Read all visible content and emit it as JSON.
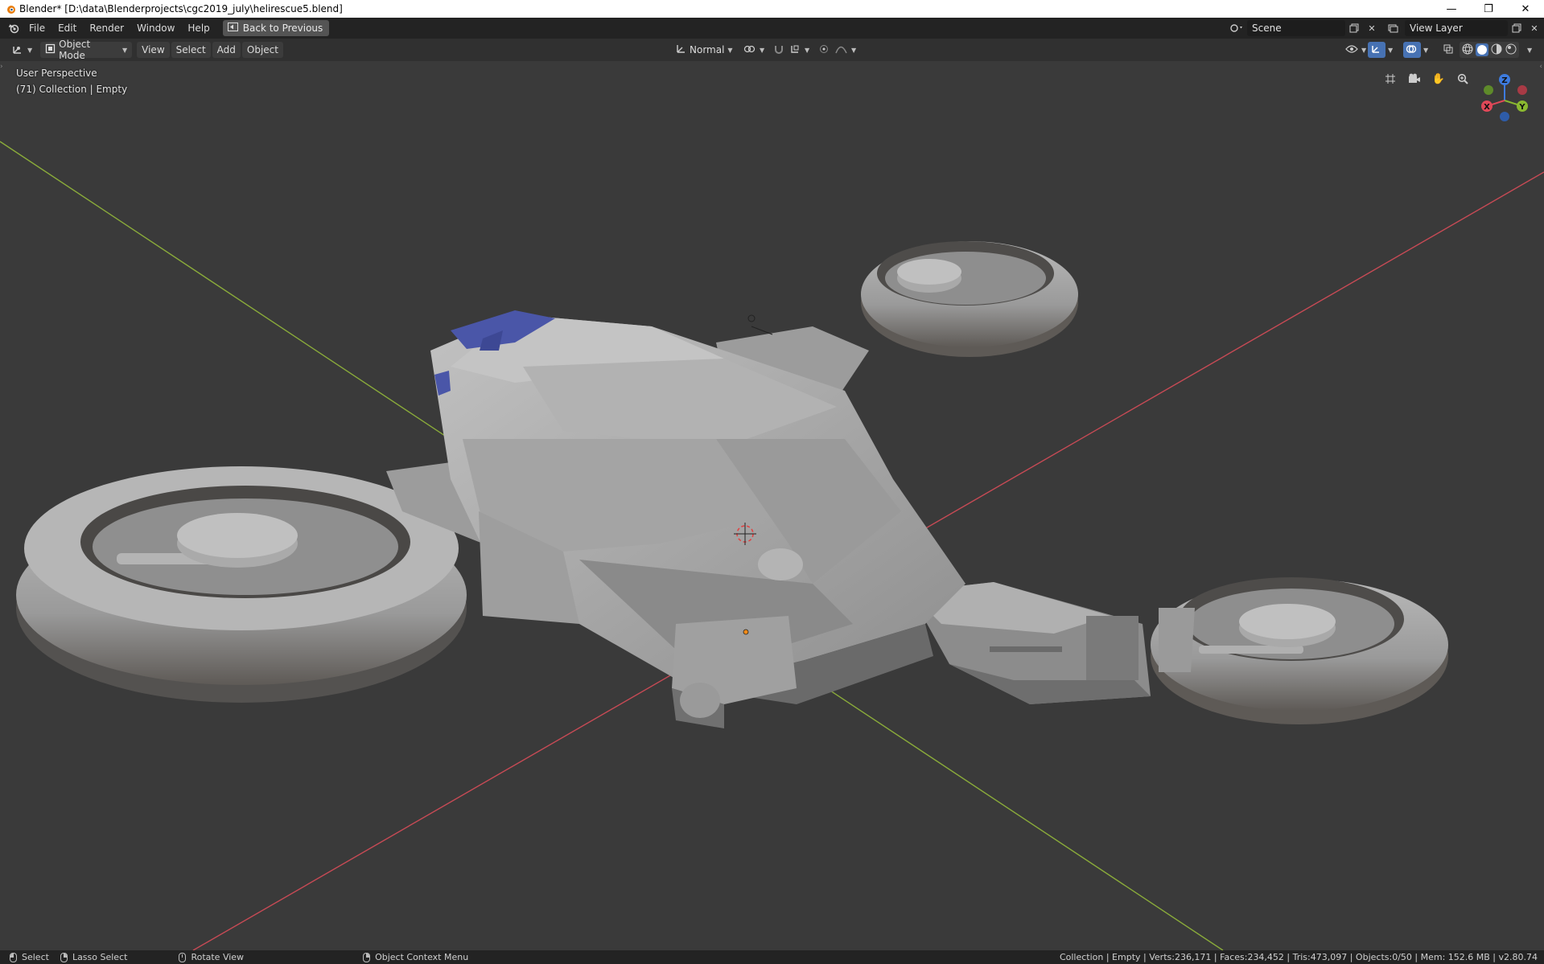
{
  "window": {
    "title": "Blender* [D:\\data\\Blenderprojects\\cgc2019_july\\helirescue5.blend]",
    "controls": {
      "minimize": "—",
      "restore": "❐",
      "close": "✕"
    }
  },
  "topbar": {
    "menus": [
      "File",
      "Edit",
      "Render",
      "Window",
      "Help"
    ],
    "back_button": "Back to Previous",
    "scene": "Scene",
    "view_layer": "View Layer"
  },
  "header": {
    "mode": "Object Mode",
    "menus": [
      "View",
      "Select",
      "Add",
      "Object"
    ],
    "orientation": "Normal"
  },
  "viewport": {
    "perspective": "User Perspective",
    "collection_info": "(71) Collection | Empty",
    "gizmo": {
      "x": "X",
      "y": "Y",
      "z": "Z"
    },
    "colors": {
      "background": "#3a3a3a",
      "axis_x": "#c74a55",
      "axis_y": "#8aab3a",
      "model": "#a8a8a8",
      "glass": "#4a56a8"
    }
  },
  "status": {
    "select": "Select",
    "lasso": "Lasso Select",
    "rotate": "Rotate View",
    "context_menu": "Object Context Menu",
    "stats": "Collection | Empty | Verts:236,171 | Faces:234,452 | Tris:473,097 | Objects:0/50 | Mem: 152.6 MB | v2.80.74"
  }
}
